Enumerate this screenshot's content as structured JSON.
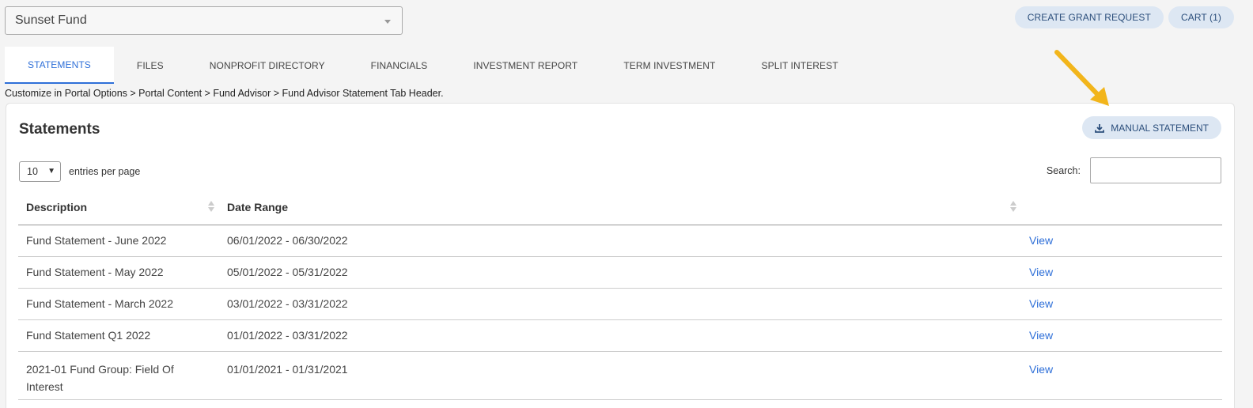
{
  "fund_selector": {
    "value": "Sunset Fund"
  },
  "top_actions": {
    "create_grant": "CREATE GRANT REQUEST",
    "cart": "CART (1)"
  },
  "tabs": [
    {
      "label": "STATEMENTS",
      "active": true
    },
    {
      "label": "FILES"
    },
    {
      "label": "NONPROFIT DIRECTORY"
    },
    {
      "label": "FINANCIALS"
    },
    {
      "label": "INVESTMENT REPORT"
    },
    {
      "label": "TERM INVESTMENT"
    },
    {
      "label": "SPLIT INTEREST"
    }
  ],
  "breadcrumb": "Customize in Portal Options > Portal Content > Fund Advisor > Fund Advisor Statement Tab Header.",
  "card": {
    "title": "Statements",
    "manual_statement": "MANUAL STATEMENT",
    "entries_value": "10",
    "entries_label": "entries per page",
    "search_label": "Search:",
    "search_value": ""
  },
  "table": {
    "columns": [
      "Description",
      "Date Range"
    ],
    "rows": [
      {
        "description": "Fund Statement - June 2022",
        "date_range": "06/01/2022 - 06/30/2022",
        "action": "View"
      },
      {
        "description": "Fund Statement - May 2022",
        "date_range": "05/01/2022 - 05/31/2022",
        "action": "View"
      },
      {
        "description": "Fund Statement - March 2022",
        "date_range": "03/01/2022 - 03/31/2022",
        "action": "View"
      },
      {
        "description": "Fund Statement Q1 2022",
        "date_range": "01/01/2022 - 03/31/2022",
        "action": "View"
      },
      {
        "description": "2021-01 Fund Group: Field Of Interest",
        "date_range": "01/01/2021 - 01/31/2021",
        "action": "View"
      }
    ]
  },
  "colors": {
    "accent": "#2e6fd8",
    "pill_bg": "#dde7f3",
    "annotation_arrow": "#f2b51b"
  }
}
